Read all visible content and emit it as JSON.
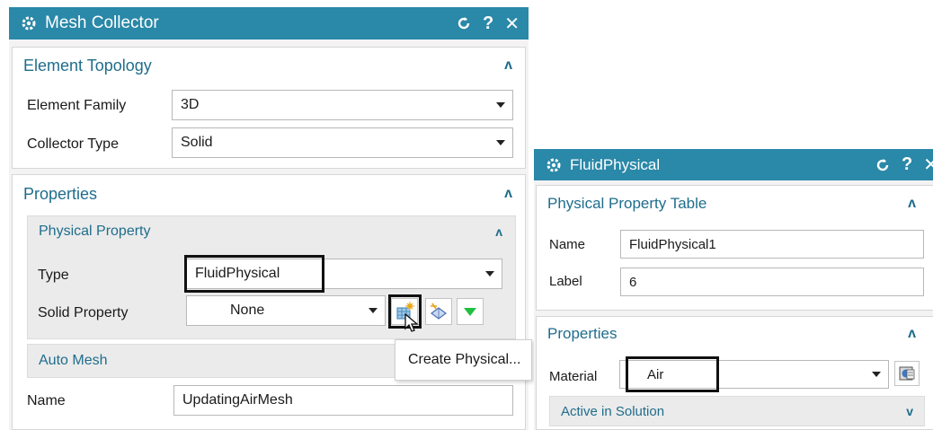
{
  "mesh_collector": {
    "title": "Mesh Collector",
    "element_topology": {
      "title": "Element Topology",
      "element_family_label": "Element Family",
      "element_family_value": "3D",
      "collector_type_label": "Collector Type",
      "collector_type_value": "Solid"
    },
    "properties": {
      "title": "Properties",
      "physical_property": {
        "title": "Physical Property",
        "type_label": "Type",
        "type_value": "FluidPhysical",
        "solid_property_label": "Solid Property",
        "solid_property_value": "None"
      },
      "auto_mesh_title": "Auto Mesh"
    },
    "name_label": "Name",
    "name_value": "UpdatingAirMesh",
    "context_menu_item": "Create Physical..."
  },
  "fluid_physical": {
    "title": "FluidPhysical",
    "table": {
      "title": "Physical Property Table",
      "name_label": "Name",
      "name_value": "FluidPhysical1",
      "label_label": "Label",
      "label_value": "6"
    },
    "properties": {
      "title": "Properties",
      "material_label": "Material",
      "material_value": "Air",
      "active_in_solution": "Active in Solution"
    }
  },
  "colors": {
    "titlebar": "#2a88a8",
    "section_title": "#1f6d8c",
    "panel_bg": "#f3f3f3"
  },
  "icons": [
    "gear-icon",
    "reset-icon",
    "help-icon",
    "close-icon",
    "chevron-up-icon",
    "chevron-down-icon",
    "create-physical-icon",
    "edit-physical-icon",
    "more-options-icon",
    "material-list-icon",
    "mouse-pointer-icon"
  ]
}
